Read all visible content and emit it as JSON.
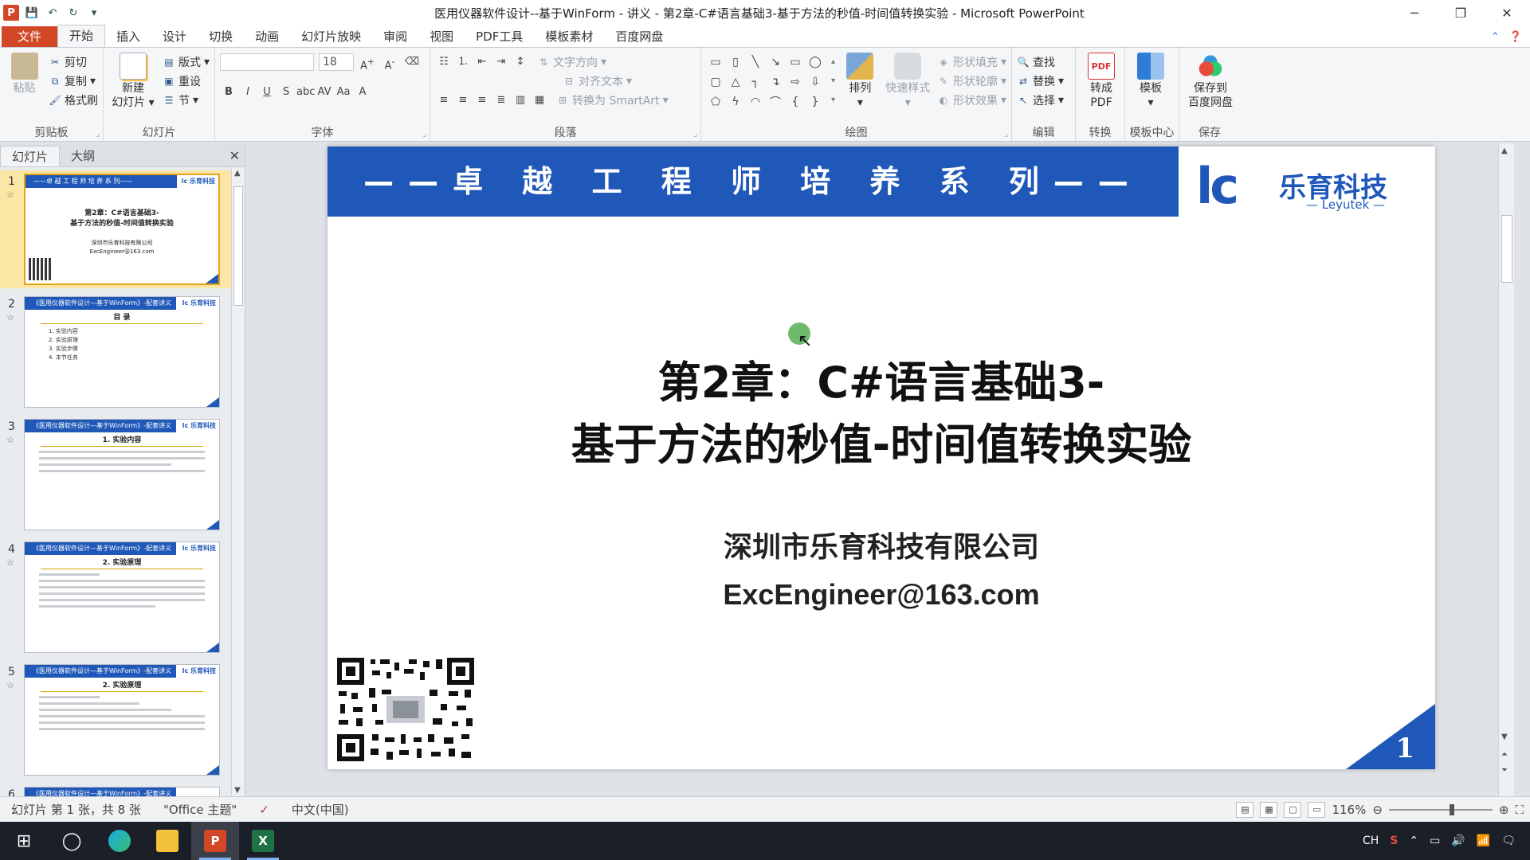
{
  "window": {
    "title": "医用仪器软件设计--基于WinForm - 讲义 - 第2章-C#语言基础3-基于方法的秒值-时间值转换实验 - Microsoft PowerPoint",
    "app_icon_label": "P"
  },
  "ribbon_tabs": [
    "文件",
    "开始",
    "插入",
    "设计",
    "切换",
    "动画",
    "幻灯片放映",
    "审阅",
    "视图",
    "PDF工具",
    "模板素材",
    "百度网盘"
  ],
  "ribbon": {
    "clipboard": {
      "label": "剪贴板",
      "paste": "粘贴",
      "cut": "剪切",
      "copy": "复制",
      "format_painter": "格式刷"
    },
    "slides": {
      "label": "幻灯片",
      "new_slide_1": "新建",
      "new_slide_2": "幻灯片",
      "layout": "版式",
      "reset": "重设",
      "section": "节"
    },
    "font": {
      "label": "字体",
      "font_size": "18"
    },
    "paragraph": {
      "label": "段落",
      "text_direction": "文字方向",
      "align_text": "对齐文本",
      "smartart": "转换为 SmartArt"
    },
    "drawing": {
      "label": "绘图",
      "arrange": "排列",
      "quick_styles": "快速样式",
      "shape_fill": "形状填充",
      "shape_outline": "形状轮廓",
      "shape_effects": "形状效果"
    },
    "editing": {
      "label": "编辑",
      "find": "查找",
      "replace": "替换",
      "select": "选择"
    },
    "convert": {
      "label": "转换",
      "to_pdf_1": "转成",
      "to_pdf_2": "PDF"
    },
    "template_center": {
      "label": "模板中心",
      "template": "模板"
    },
    "save": {
      "label": "保存",
      "save_1": "保存到",
      "save_2": "百度网盘"
    }
  },
  "left_pane": {
    "tabs": [
      "幻灯片",
      "大纲"
    ],
    "slides": [
      {
        "num": "1",
        "type": "title",
        "line1": "第2章：C#语言基础3-",
        "line2": "基于方法的秒值-时间值转换实验",
        "line3": "深圳市乐育科技有限公司",
        "line4": "ExcEngineer@163.com",
        "bar": "——卓 越 工 程 师 培 养 系 列——"
      },
      {
        "num": "2",
        "type": "toc",
        "bar": "《医用仪器软件设计—基于WinForm》-配套讲义",
        "subtitle": "目 录",
        "items": [
          "1. 实验内容",
          "2. 实验原理",
          "3. 实验步骤",
          "4. 本节任务"
        ]
      },
      {
        "num": "3",
        "type": "text",
        "bar": "《医用仪器软件设计—基于WinForm》-配套讲义",
        "subtitle": "1. 实验内容"
      },
      {
        "num": "4",
        "type": "text",
        "bar": "《医用仪器软件设计—基于WinForm》-配套讲义",
        "subtitle": "2. 实验原理"
      },
      {
        "num": "5",
        "type": "text",
        "bar": "《医用仪器软件设计—基于WinForm》-配套讲义",
        "subtitle": "2. 实验原理"
      },
      {
        "num": "6",
        "type": "text",
        "bar": "《医用仪器软件设计—基于WinForm》-配套讲义",
        "subtitle": ""
      }
    ]
  },
  "slide": {
    "banner": "——卓 越 工 程 师 培 养 系 列——",
    "logo_mark": "lc",
    "logo_cn": "乐育科技",
    "logo_en": "— Leyutek —",
    "title_line1": "第2章：C#语言基础3-",
    "title_line2": "基于方法的秒值-时间值转换实验",
    "company": "深圳市乐育科技有限公司",
    "email": "ExcEngineer@163.com",
    "number": "1"
  },
  "status": {
    "slide_info": "幻灯片 第 1 张，共 8 张",
    "theme": "\"Office 主题\"",
    "language": "中文(中国)",
    "zoom": "116%"
  },
  "taskbar": {
    "tray_ime": "CH"
  }
}
